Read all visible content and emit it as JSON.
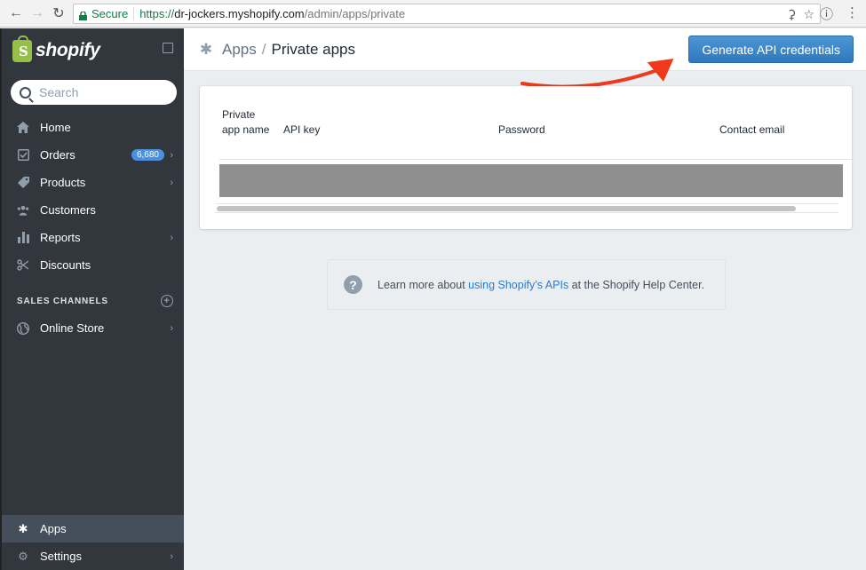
{
  "browser": {
    "secure_label": "Secure",
    "url_scheme": "https://",
    "url_host": "dr-jockers.myshopify.com",
    "url_path": "/admin/apps/private"
  },
  "sidebar": {
    "brand": "shopify",
    "search_placeholder": "Search",
    "items": [
      {
        "label": "Home",
        "icon": "home-icon"
      },
      {
        "label": "Orders",
        "icon": "orders-icon",
        "badge": "6,680"
      },
      {
        "label": "Products",
        "icon": "tag-icon"
      },
      {
        "label": "Customers",
        "icon": "customers-icon"
      },
      {
        "label": "Reports",
        "icon": "reports-icon"
      },
      {
        "label": "Discounts",
        "icon": "discounts-icon"
      }
    ],
    "sales_channels_title": "SALES CHANNELS",
    "online_store": "Online Store",
    "apps": "Apps",
    "settings": "Settings"
  },
  "header": {
    "crumb_parent": "Apps",
    "crumb_sep": "/",
    "crumb_current": "Private apps",
    "generate_button": "Generate API credentials"
  },
  "table": {
    "columns": {
      "name": "Private app name",
      "api_key": "API key",
      "password": "Password",
      "contact_email": "Contact email"
    }
  },
  "help": {
    "prefix": "Learn more about ",
    "link": "using Shopify’s APIs",
    "suffix": " at the Shopify Help Center."
  },
  "colors": {
    "sidebar_bg": "#31373d",
    "primary_button": "#3f85c6",
    "annotation_arrow": "#f0391b",
    "link": "#2e7bc4"
  }
}
